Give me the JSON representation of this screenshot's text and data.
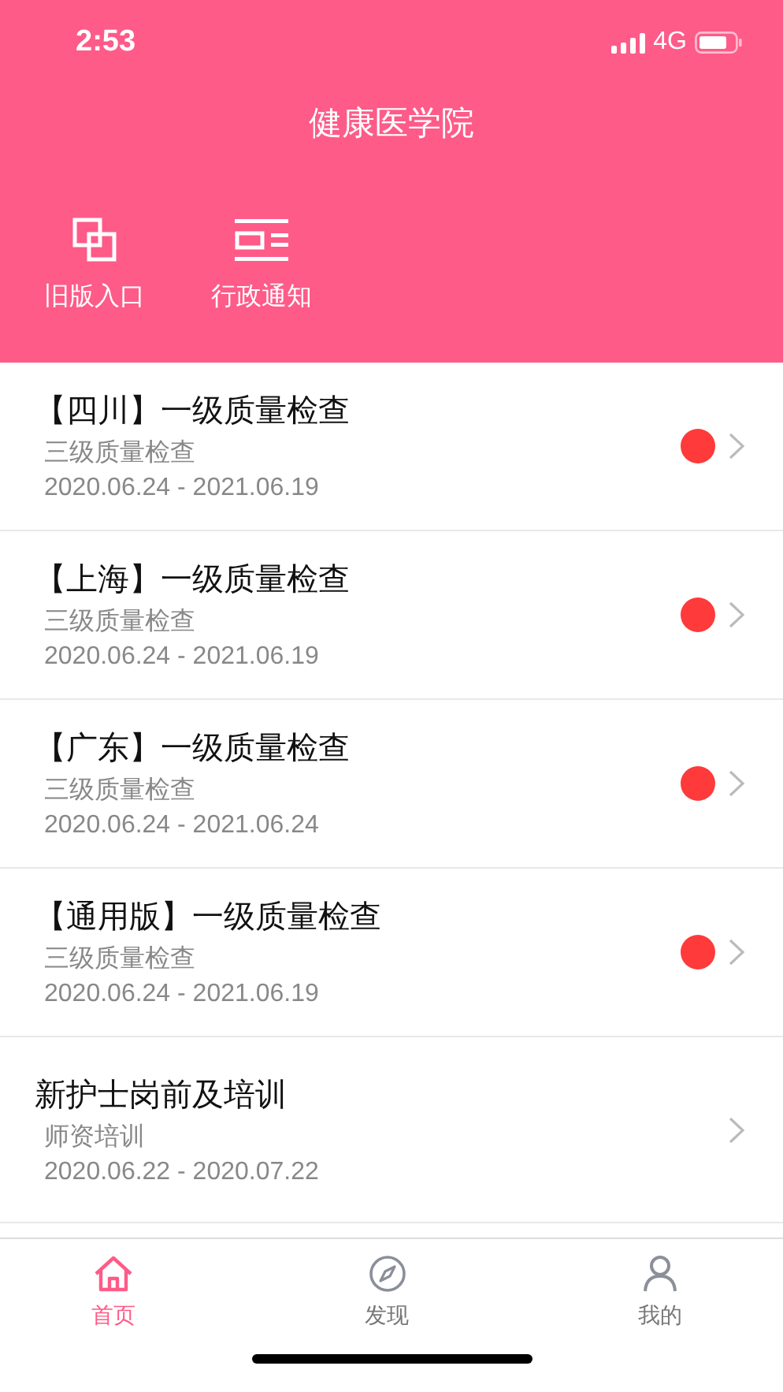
{
  "status_bar": {
    "time": "2:53",
    "network": "4G"
  },
  "header": {
    "title": "健康医学院"
  },
  "shortcuts": [
    {
      "label": "旧版入口"
    },
    {
      "label": "行政通知"
    }
  ],
  "list": [
    {
      "title": "【四川】一级质量检查",
      "subtitle": "三级质量检查",
      "dates": "2020.06.24 - 2021.06.19",
      "unread": true
    },
    {
      "title": "【上海】一级质量检查",
      "subtitle": "三级质量检查",
      "dates": "2020.06.24 - 2021.06.19",
      "unread": true
    },
    {
      "title": "【广东】一级质量检查",
      "subtitle": "三级质量检查",
      "dates": "2020.06.24 - 2021.06.24",
      "unread": true
    },
    {
      "title": "【通用版】一级质量检查",
      "subtitle": "三级质量检查",
      "dates": "2020.06.24 - 2021.06.19",
      "unread": true
    },
    {
      "title": "新护士岗前及培训",
      "subtitle": "师资培训",
      "dates": "2020.06.22 - 2020.07.22",
      "unread": false
    }
  ],
  "tab_bar": [
    {
      "label": "首页",
      "selected": true
    },
    {
      "label": "发现",
      "selected": false
    },
    {
      "label": "我的",
      "selected": false
    }
  ]
}
